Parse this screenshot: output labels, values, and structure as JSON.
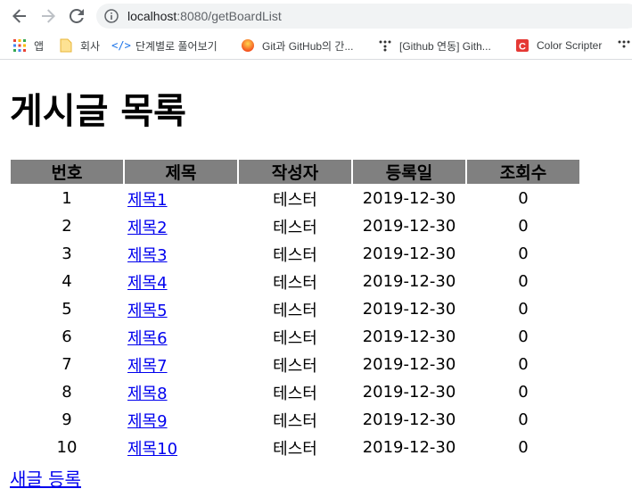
{
  "browser": {
    "url_host": "localhost",
    "url_rest": ":8080/getBoardList",
    "bookmarks": [
      {
        "icon": "apps-grid-icon",
        "label": "앱"
      },
      {
        "icon": "folder-icon",
        "label": "회사"
      },
      {
        "icon": "code-icon",
        "label": "단계별로 풀어보기"
      },
      {
        "icon": "orange-circle-icon",
        "label": "Git과 GitHub의 간..."
      },
      {
        "icon": "dots-icon",
        "label": "[Github 연동] Gith..."
      },
      {
        "icon": "color-scripter-icon",
        "label": "Color Scripter"
      }
    ]
  },
  "page": {
    "title": "게시글 목록",
    "new_post_link": "새글 등록",
    "table": {
      "headers": [
        "번호",
        "제목",
        "작성자",
        "등록일",
        "조회수"
      ],
      "rows": [
        {
          "no": "1",
          "title": "제목1",
          "writer": "테스터",
          "date": "2019-12-30",
          "views": "0"
        },
        {
          "no": "2",
          "title": "제목2",
          "writer": "테스터",
          "date": "2019-12-30",
          "views": "0"
        },
        {
          "no": "3",
          "title": "제목3",
          "writer": "테스터",
          "date": "2019-12-30",
          "views": "0"
        },
        {
          "no": "4",
          "title": "제목4",
          "writer": "테스터",
          "date": "2019-12-30",
          "views": "0"
        },
        {
          "no": "5",
          "title": "제목5",
          "writer": "테스터",
          "date": "2019-12-30",
          "views": "0"
        },
        {
          "no": "6",
          "title": "제목6",
          "writer": "테스터",
          "date": "2019-12-30",
          "views": "0"
        },
        {
          "no": "7",
          "title": "제목7",
          "writer": "테스터",
          "date": "2019-12-30",
          "views": "0"
        },
        {
          "no": "8",
          "title": "제목8",
          "writer": "테스터",
          "date": "2019-12-30",
          "views": "0"
        },
        {
          "no": "9",
          "title": "제목9",
          "writer": "테스터",
          "date": "2019-12-30",
          "views": "0"
        },
        {
          "no": "10",
          "title": "제목10",
          "writer": "테스터",
          "date": "2019-12-30",
          "views": "0"
        }
      ]
    }
  },
  "colors": {
    "header_bg": "#808080",
    "link": "#0000ee",
    "omnibox_bg": "#f1f3f4"
  }
}
